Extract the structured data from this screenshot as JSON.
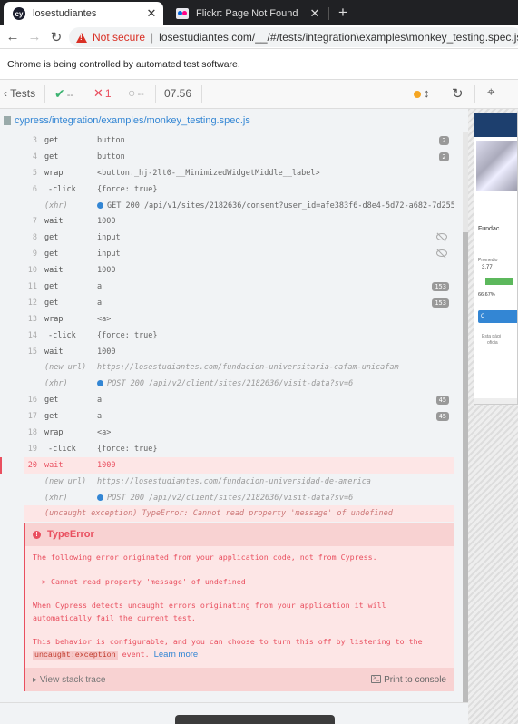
{
  "browser": {
    "tabs": [
      {
        "title": "losestudiantes",
        "close": "✕"
      },
      {
        "title": "Flickr: Page Not Found",
        "close": "✕"
      }
    ],
    "new_tab": "+",
    "not_secure": "Not secure",
    "url": "losestudiantes.com/__/#/tests/integration\\examples\\monkey_testing.spec.js",
    "infobar": "Chrome is being controlled by automated test software."
  },
  "cypress": {
    "tests_label": "Tests",
    "passed": "--",
    "failed": "1",
    "pending": "--",
    "duration": "07.56",
    "spec_path": "cypress/integration/examples/monkey_testing.spec.js"
  },
  "commands": [
    {
      "num": "3",
      "name": "get",
      "msg": "button",
      "badge": "2"
    },
    {
      "num": "4",
      "name": "get",
      "msg": "button",
      "badge": "2"
    },
    {
      "num": "5",
      "name": "wrap",
      "msg": "<button._hj-2lt0-__MinimizedWidgetMiddle__label>"
    },
    {
      "num": "6",
      "name": "-click",
      "msg": "{force: true}"
    },
    {
      "num": "",
      "name": "(xhr)",
      "msg": "GET 200 /api/v1/sites/2182636/consent?user_id=afe383f6-d8e4-5d72-a682-7d255…"
    },
    {
      "num": "7",
      "name": "wait",
      "msg": "1000"
    },
    {
      "num": "8",
      "name": "get",
      "msg": "input"
    },
    {
      "num": "9",
      "name": "get",
      "msg": "input"
    },
    {
      "num": "10",
      "name": "wait",
      "msg": "1000"
    },
    {
      "num": "11",
      "name": "get",
      "msg": "a",
      "badge": "153"
    },
    {
      "num": "12",
      "name": "get",
      "msg": "a",
      "badge": "153"
    },
    {
      "num": "13",
      "name": "wrap",
      "msg": "<a>"
    },
    {
      "num": "14",
      "name": "-click",
      "msg": "{force: true}"
    },
    {
      "num": "15",
      "name": "wait",
      "msg": "1000"
    },
    {
      "num": "",
      "name": "(new url)",
      "msg": "https://losestudiantes.com/fundacion-universitaria-cafam-unicafam"
    },
    {
      "num": "",
      "name": "(xhr)",
      "msg": "POST 200 /api/v2/client/sites/2182636/visit-data?sv=6"
    },
    {
      "num": "16",
      "name": "get",
      "msg": "a",
      "badge": "45"
    },
    {
      "num": "17",
      "name": "get",
      "msg": "a",
      "badge": "45"
    },
    {
      "num": "18",
      "name": "wrap",
      "msg": "<a>"
    },
    {
      "num": "19",
      "name": "-click",
      "msg": "{force: true}"
    },
    {
      "num": "20",
      "name": "wait",
      "msg": "1000"
    },
    {
      "num": "",
      "name": "(new url)",
      "msg": "https://losestudiantes.com/fundacion-universidad-de-america"
    },
    {
      "num": "",
      "name": "(xhr)",
      "msg": "POST 200 /api/v2/client/sites/2182636/visit-data?sv=6"
    },
    {
      "num": "",
      "name": "",
      "msg": "(uncaught exception) TypeError: Cannot read property 'message' of undefined"
    }
  ],
  "error": {
    "title": "TypeError",
    "line1": "The following error originated from your application code, not from Cypress.",
    "line2": "> Cannot read property 'message' of undefined",
    "line3": "When Cypress detects uncaught errors originating from your application it will automatically fail the current test.",
    "line4_a": "This behavior is configurable, and you can choose to turn this off by listening to the",
    "line4_code": "uncaught:exception",
    "line4_b": "event.",
    "learn_more": "Learn more",
    "view_stack": "View stack trace",
    "print_console": "Print to console"
  },
  "preview": {
    "name": "Fundac",
    "small": "Promedio",
    "score": "3.77",
    "pct": "66.67%",
    "btn": "C",
    "desc1": "Esta pági",
    "desc2": "oficia"
  }
}
